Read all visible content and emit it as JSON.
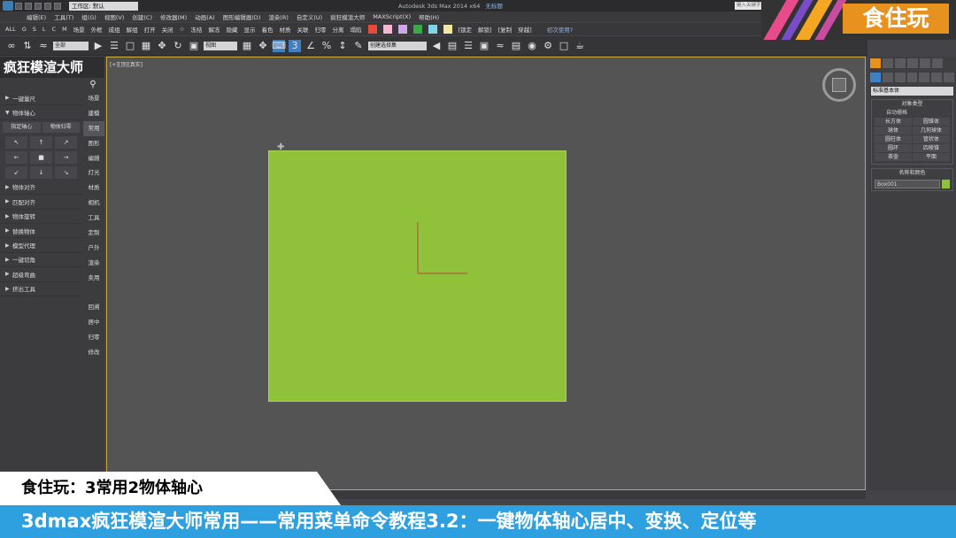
{
  "titlebar": {
    "workspace": "工作区: 默认",
    "app_title": "Autodesk 3ds Max  2014 x64",
    "file_status": "无标题",
    "search_placeholder": "键入关键字或短语"
  },
  "menubar": {
    "items": [
      "编辑(E)",
      "工具(T)",
      "组(G)",
      "视图(V)",
      "创建(C)",
      "修改器(M)",
      "动画(A)",
      "图形编辑器(D)",
      "渲染(R)",
      "自定义(U)",
      "疯狂模渲大师",
      "MAXScript(X)",
      "帮助(H)"
    ]
  },
  "toolbar1": {
    "filters": [
      "ALL",
      "G",
      "S",
      "L",
      "C",
      "M"
    ],
    "items": [
      "场景",
      "外框",
      "成组",
      "解组",
      "打开",
      "关闭",
      "☆",
      "冻结",
      "解冻",
      "隐藏",
      "显示",
      "着色",
      "材质",
      "关联",
      "归零",
      "分离",
      "塌陷"
    ],
    "swatches": [
      "#e84a3a",
      "#f7b6d2",
      "#cfa6e8",
      "#3aa84a",
      "#7ed6e8",
      "#f0e8a0"
    ],
    "right_items": [
      "[锁定",
      "解锁]",
      "[复制",
      "穿越]"
    ],
    "first_use": "初次使用?"
  },
  "toolbar2": {
    "filter_value": "全部",
    "ref_coord": "视图",
    "selection_set": "创建选择集"
  },
  "brand": {
    "name": "食住玩"
  },
  "leftpanel": {
    "title": "疯狂模渲大师",
    "menu": {
      "one_key_scale": "一键量尺",
      "pivot": "物体轴心",
      "pivot_buttons": [
        "指定轴心",
        "物体归零"
      ],
      "pivot_grid": [
        "↖",
        "↑",
        "↗",
        "←",
        "■",
        "→",
        "↙",
        "↓",
        "↘"
      ],
      "items": [
        "物体对齐",
        "匹配对齐",
        "物体旋转",
        "替换物体",
        "模型代理",
        "一键切角",
        "超级弯曲",
        "挤出工具"
      ]
    },
    "tabs": [
      "场景",
      "建模",
      "常用",
      "图形",
      "编辑",
      "灯光",
      "材质",
      "相机",
      "工具",
      "定制",
      "户外",
      "渲染",
      "卖用",
      "",
      "回溯",
      "居中",
      "归零",
      "修改"
    ],
    "active_tab_index": 2
  },
  "viewport": {
    "label": "[+][顶][真实]"
  },
  "rightpanel": {
    "primitive_type": "标准基本体",
    "object_type_title": "对象类型",
    "autogrid": "自动栅格",
    "primitives": [
      "长方体",
      "圆锥体",
      "球体",
      "几何球体",
      "圆柱体",
      "管状体",
      "圆环",
      "四棱锥",
      "茶壶",
      "平面"
    ],
    "name_color_title": "名称和颜色",
    "object_name": "Box001",
    "object_color": "#8fc13a"
  },
  "subtitles": {
    "small": "食住玩：3常用2物体轴心",
    "main": "3dmax疯狂模渲大师常用——常用菜单命令教程3.2：一键物体轴心居中、变换、定位等"
  }
}
